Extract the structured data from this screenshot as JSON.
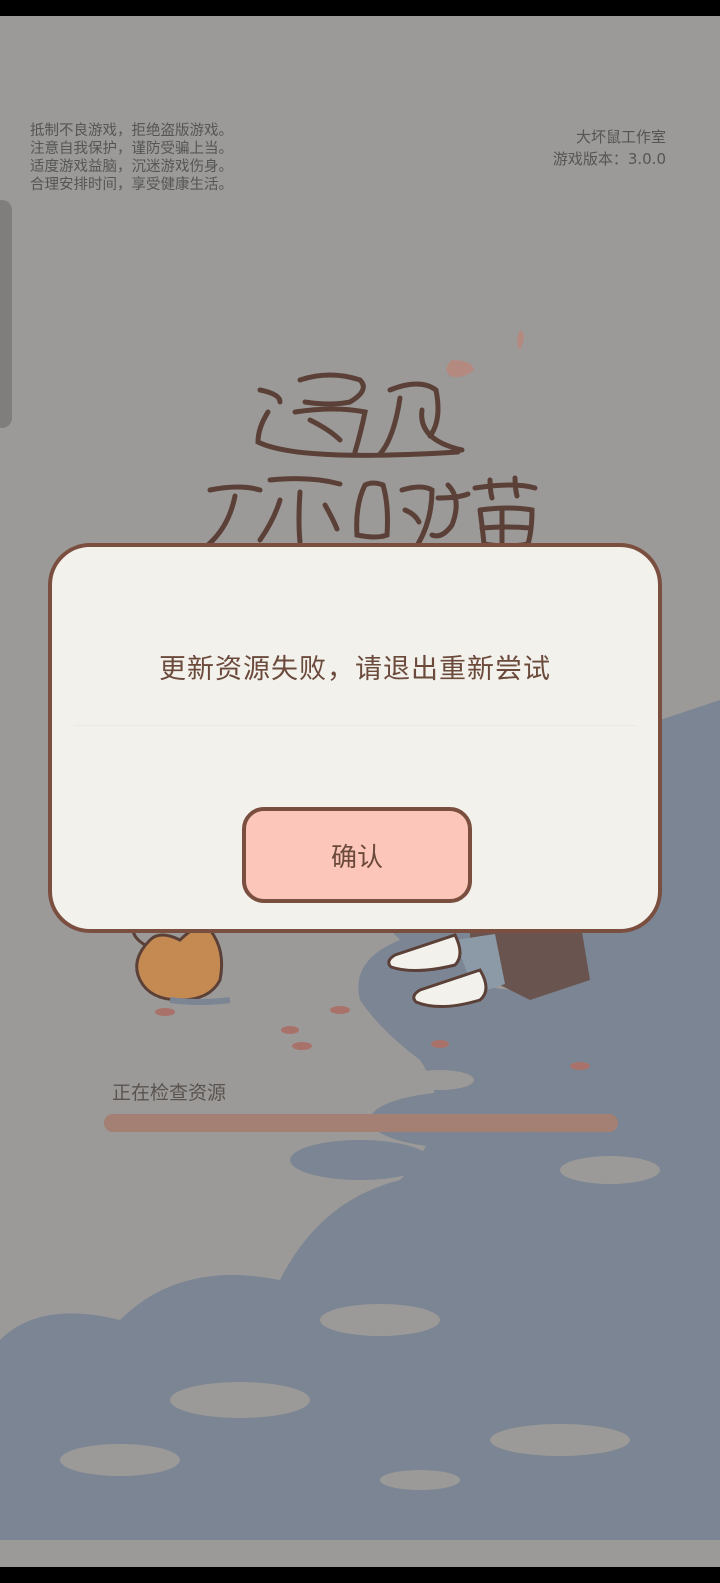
{
  "notice": {
    "lines": "抵制不良游戏，拒绝盗版游戏。\n注意自我保护，谨防受骗上当。\n适度游戏益脑，沉迷游戏伤身。\n合理安排时间，享受健康生活。"
  },
  "studio": {
    "name": "大坏鼠工作室",
    "version": "游戏版本：3.0.0"
  },
  "logo": {
    "line1": "遇见",
    "line2": "你的猫"
  },
  "loading": {
    "text": "正在检查资源",
    "progress": 1.0
  },
  "dialog": {
    "message": "更新资源失败，请退出重新尝试",
    "confirm_label": "确认"
  },
  "colors": {
    "dialog_border": "#7b4f40",
    "dialog_bg": "#f3f1ec",
    "button_bg": "#fcc7ba",
    "text_brown": "#6b4a3c"
  }
}
